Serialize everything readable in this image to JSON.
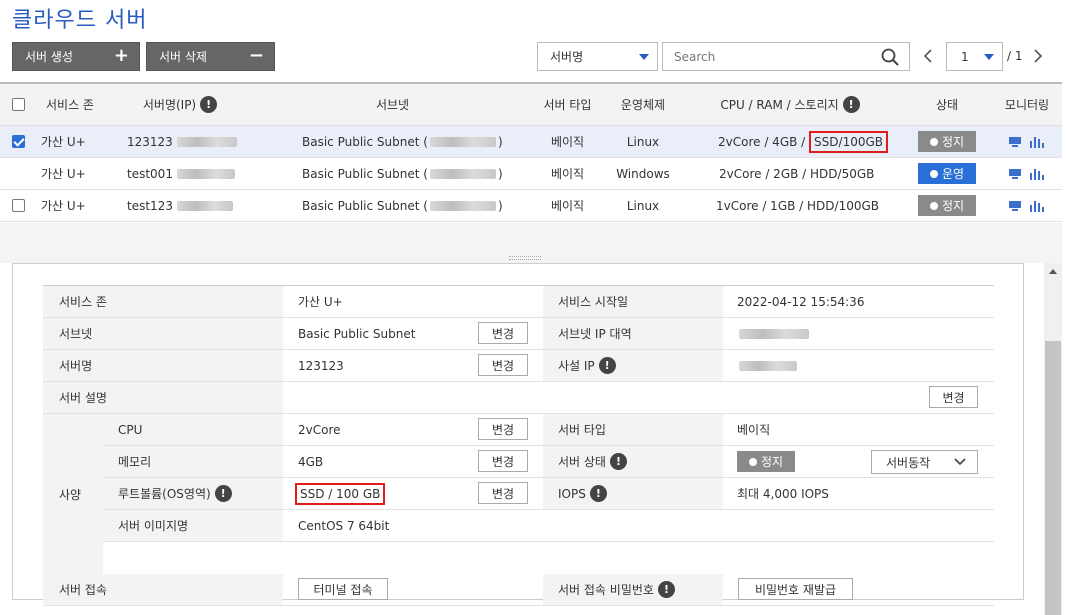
{
  "page": {
    "title": "클라우드 서버"
  },
  "toolbar": {
    "create_label": "서버 생성",
    "delete_label": "서버 삭제"
  },
  "filter": {
    "field": "서버명",
    "search_placeholder": "Search"
  },
  "pager": {
    "page": "1",
    "total": "/ 1"
  },
  "grid": {
    "headers": {
      "zone": "서비스 존",
      "name": "서버명(IP)",
      "subnet": "서브넷",
      "type": "서버 타입",
      "os": "운영체제",
      "spec": "CPU / RAM / 스토리지",
      "status": "상태",
      "monitor": "모니터링"
    },
    "rows": [
      {
        "zone": "가산 U+",
        "name": "123123",
        "subnet": "Basic Public Subnet (",
        "type": "베이직",
        "os": "Linux",
        "spec_main": "2vCore / 4GB /",
        "spec_storage": "SSD/100GB",
        "status": "정지"
      },
      {
        "zone": "가산 U+",
        "name": "test001",
        "subnet": "Basic Public Subnet (",
        "type": "베이직",
        "os": "Windows",
        "spec_main": "2vCore / 2GB / HDD/50GB",
        "status": "운영"
      },
      {
        "zone": "가산 U+",
        "name": "test123",
        "subnet": "Basic Public Subnet (",
        "type": "베이직",
        "os": "Linux",
        "spec_main": "1vCore / 1GB / HDD/100GB",
        "status": "정지"
      }
    ],
    "close_paren": ")"
  },
  "detail": {
    "zone_label": "서비스 존",
    "zone_value": "가산 U+",
    "start_label": "서비스 시작일",
    "start_value": "2022-04-12 15:54:36",
    "subnet_label": "서브넷",
    "subnet_value": "Basic Public Subnet",
    "subnet_ip_label": "서브넷 IP 대역",
    "name_label": "서버명",
    "name_value": "123123",
    "private_ip_label": "사설 IP",
    "desc_label": "서버 설명",
    "spec_label": "사양",
    "cpu_label": "CPU",
    "cpu_value": "2vCore",
    "server_type_label": "서버 타입",
    "server_type_value": "베이직",
    "mem_label": "메모리",
    "mem_value": "4GB",
    "server_status_label": "서버 상태",
    "server_status_value": "정지",
    "server_action": "서버동작",
    "root_label": "루트볼륨(OS영역)",
    "root_value": "SSD / 100 GB",
    "iops_label": "IOPS",
    "iops_value": "최대 4,000 IOPS",
    "image_label": "서버 이미지명",
    "image_value": "CentOS 7 64bit",
    "access_label": "서버 접속",
    "terminal_btn": "터미널 접속",
    "pw_label": "서버 접속 비밀번호",
    "pw_btn": "비밀번호 재발급",
    "change_btn": "변경"
  }
}
